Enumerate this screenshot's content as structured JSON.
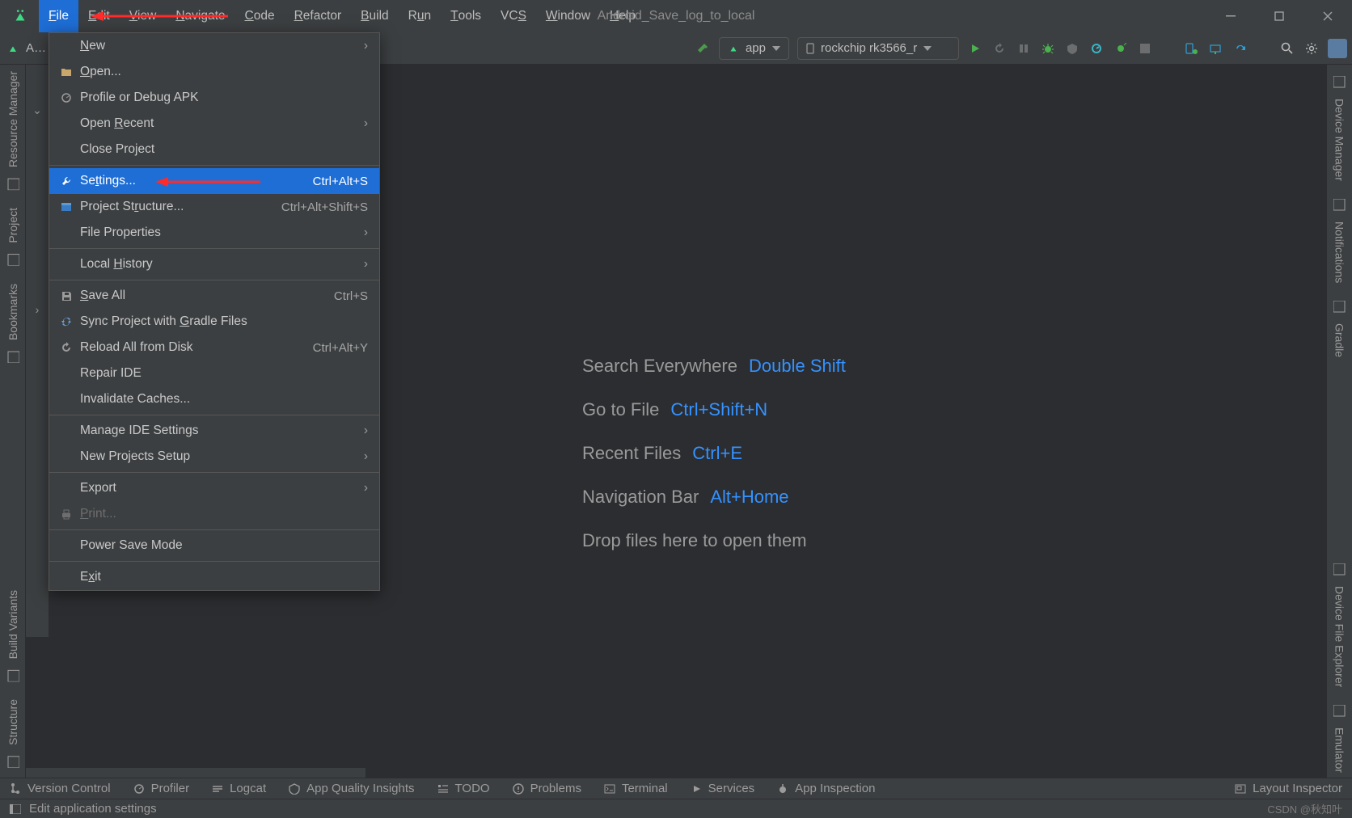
{
  "window": {
    "title": "Android_Save_log_to_local"
  },
  "menubar": [
    "File",
    "Edit",
    "View",
    "Navigate",
    "Code",
    "Refactor",
    "Build",
    "Run",
    "Tools",
    "VCS",
    "Window",
    "Help"
  ],
  "menubar_mnemonic_index": [
    0,
    0,
    0,
    0,
    0,
    0,
    0,
    1,
    0,
    2,
    0,
    0
  ],
  "toolbar": {
    "breadcrumb": "A…",
    "run_config": "app",
    "device": "rockchip rk3566_r"
  },
  "file_menu": [
    {
      "type": "item",
      "label": "New",
      "mn": 0,
      "sub": true,
      "icon": ""
    },
    {
      "type": "item",
      "label": "Open...",
      "mn": 0,
      "icon": "open"
    },
    {
      "type": "item",
      "label": "Profile or Debug APK",
      "mn": -1,
      "icon": "profile"
    },
    {
      "type": "item",
      "label": "Open Recent",
      "mn": 5,
      "sub": true
    },
    {
      "type": "item",
      "label": "Close Project",
      "mn": -1
    },
    {
      "type": "sep"
    },
    {
      "type": "item",
      "label": "Settings...",
      "mn": 2,
      "shortcut": "Ctrl+Alt+S",
      "icon": "wrench",
      "selected": true
    },
    {
      "type": "item",
      "label": "Project Structure...",
      "mn": 10,
      "shortcut": "Ctrl+Alt+Shift+S",
      "icon": "structure"
    },
    {
      "type": "item",
      "label": "File Properties",
      "mn": -1,
      "sub": true
    },
    {
      "type": "sep"
    },
    {
      "type": "item",
      "label": "Local History",
      "mn": 6,
      "sub": true
    },
    {
      "type": "sep"
    },
    {
      "type": "item",
      "label": "Save All",
      "mn": 0,
      "shortcut": "Ctrl+S",
      "icon": "save"
    },
    {
      "type": "item",
      "label": "Sync Project with Gradle Files",
      "mn": 18,
      "icon": "sync"
    },
    {
      "type": "item",
      "label": "Reload All from Disk",
      "mn": -1,
      "shortcut": "Ctrl+Alt+Y",
      "icon": "reload"
    },
    {
      "type": "item",
      "label": "Repair IDE",
      "mn": -1
    },
    {
      "type": "item",
      "label": "Invalidate Caches...",
      "mn": -1
    },
    {
      "type": "sep"
    },
    {
      "type": "item",
      "label": "Manage IDE Settings",
      "mn": -1,
      "sub": true
    },
    {
      "type": "item",
      "label": "New Projects Setup",
      "mn": -1,
      "sub": true
    },
    {
      "type": "sep"
    },
    {
      "type": "item",
      "label": "Export",
      "mn": -1,
      "sub": true
    },
    {
      "type": "item",
      "label": "Print...",
      "mn": 0,
      "disabled": true,
      "icon": "print"
    },
    {
      "type": "sep"
    },
    {
      "type": "item",
      "label": "Power Save Mode",
      "mn": -1
    },
    {
      "type": "sep"
    },
    {
      "type": "item",
      "label": "Exit",
      "mn": 1
    }
  ],
  "left_tools": [
    "Resource Manager",
    "Project",
    "Bookmarks",
    "Build Variants",
    "Structure"
  ],
  "right_tools": [
    "Device Manager",
    "Notifications",
    "Gradle",
    "Device File Explorer",
    "Emulator"
  ],
  "hints": [
    {
      "label": "Search Everywhere",
      "key": "Double Shift"
    },
    {
      "label": "Go to File",
      "key": "Ctrl+Shift+N"
    },
    {
      "label": "Recent Files",
      "key": "Ctrl+E"
    },
    {
      "label": "Navigation Bar",
      "key": "Alt+Home"
    },
    {
      "label": "Drop files here to open them",
      "key": ""
    }
  ],
  "bottom_tools": [
    "Version Control",
    "Profiler",
    "Logcat",
    "App Quality Insights",
    "TODO",
    "Problems",
    "Terminal",
    "Services",
    "App Inspection"
  ],
  "bottom_right": "Layout Inspector",
  "statusbar": {
    "text": "Edit application settings",
    "watermark": "CSDN @秋知叶"
  }
}
